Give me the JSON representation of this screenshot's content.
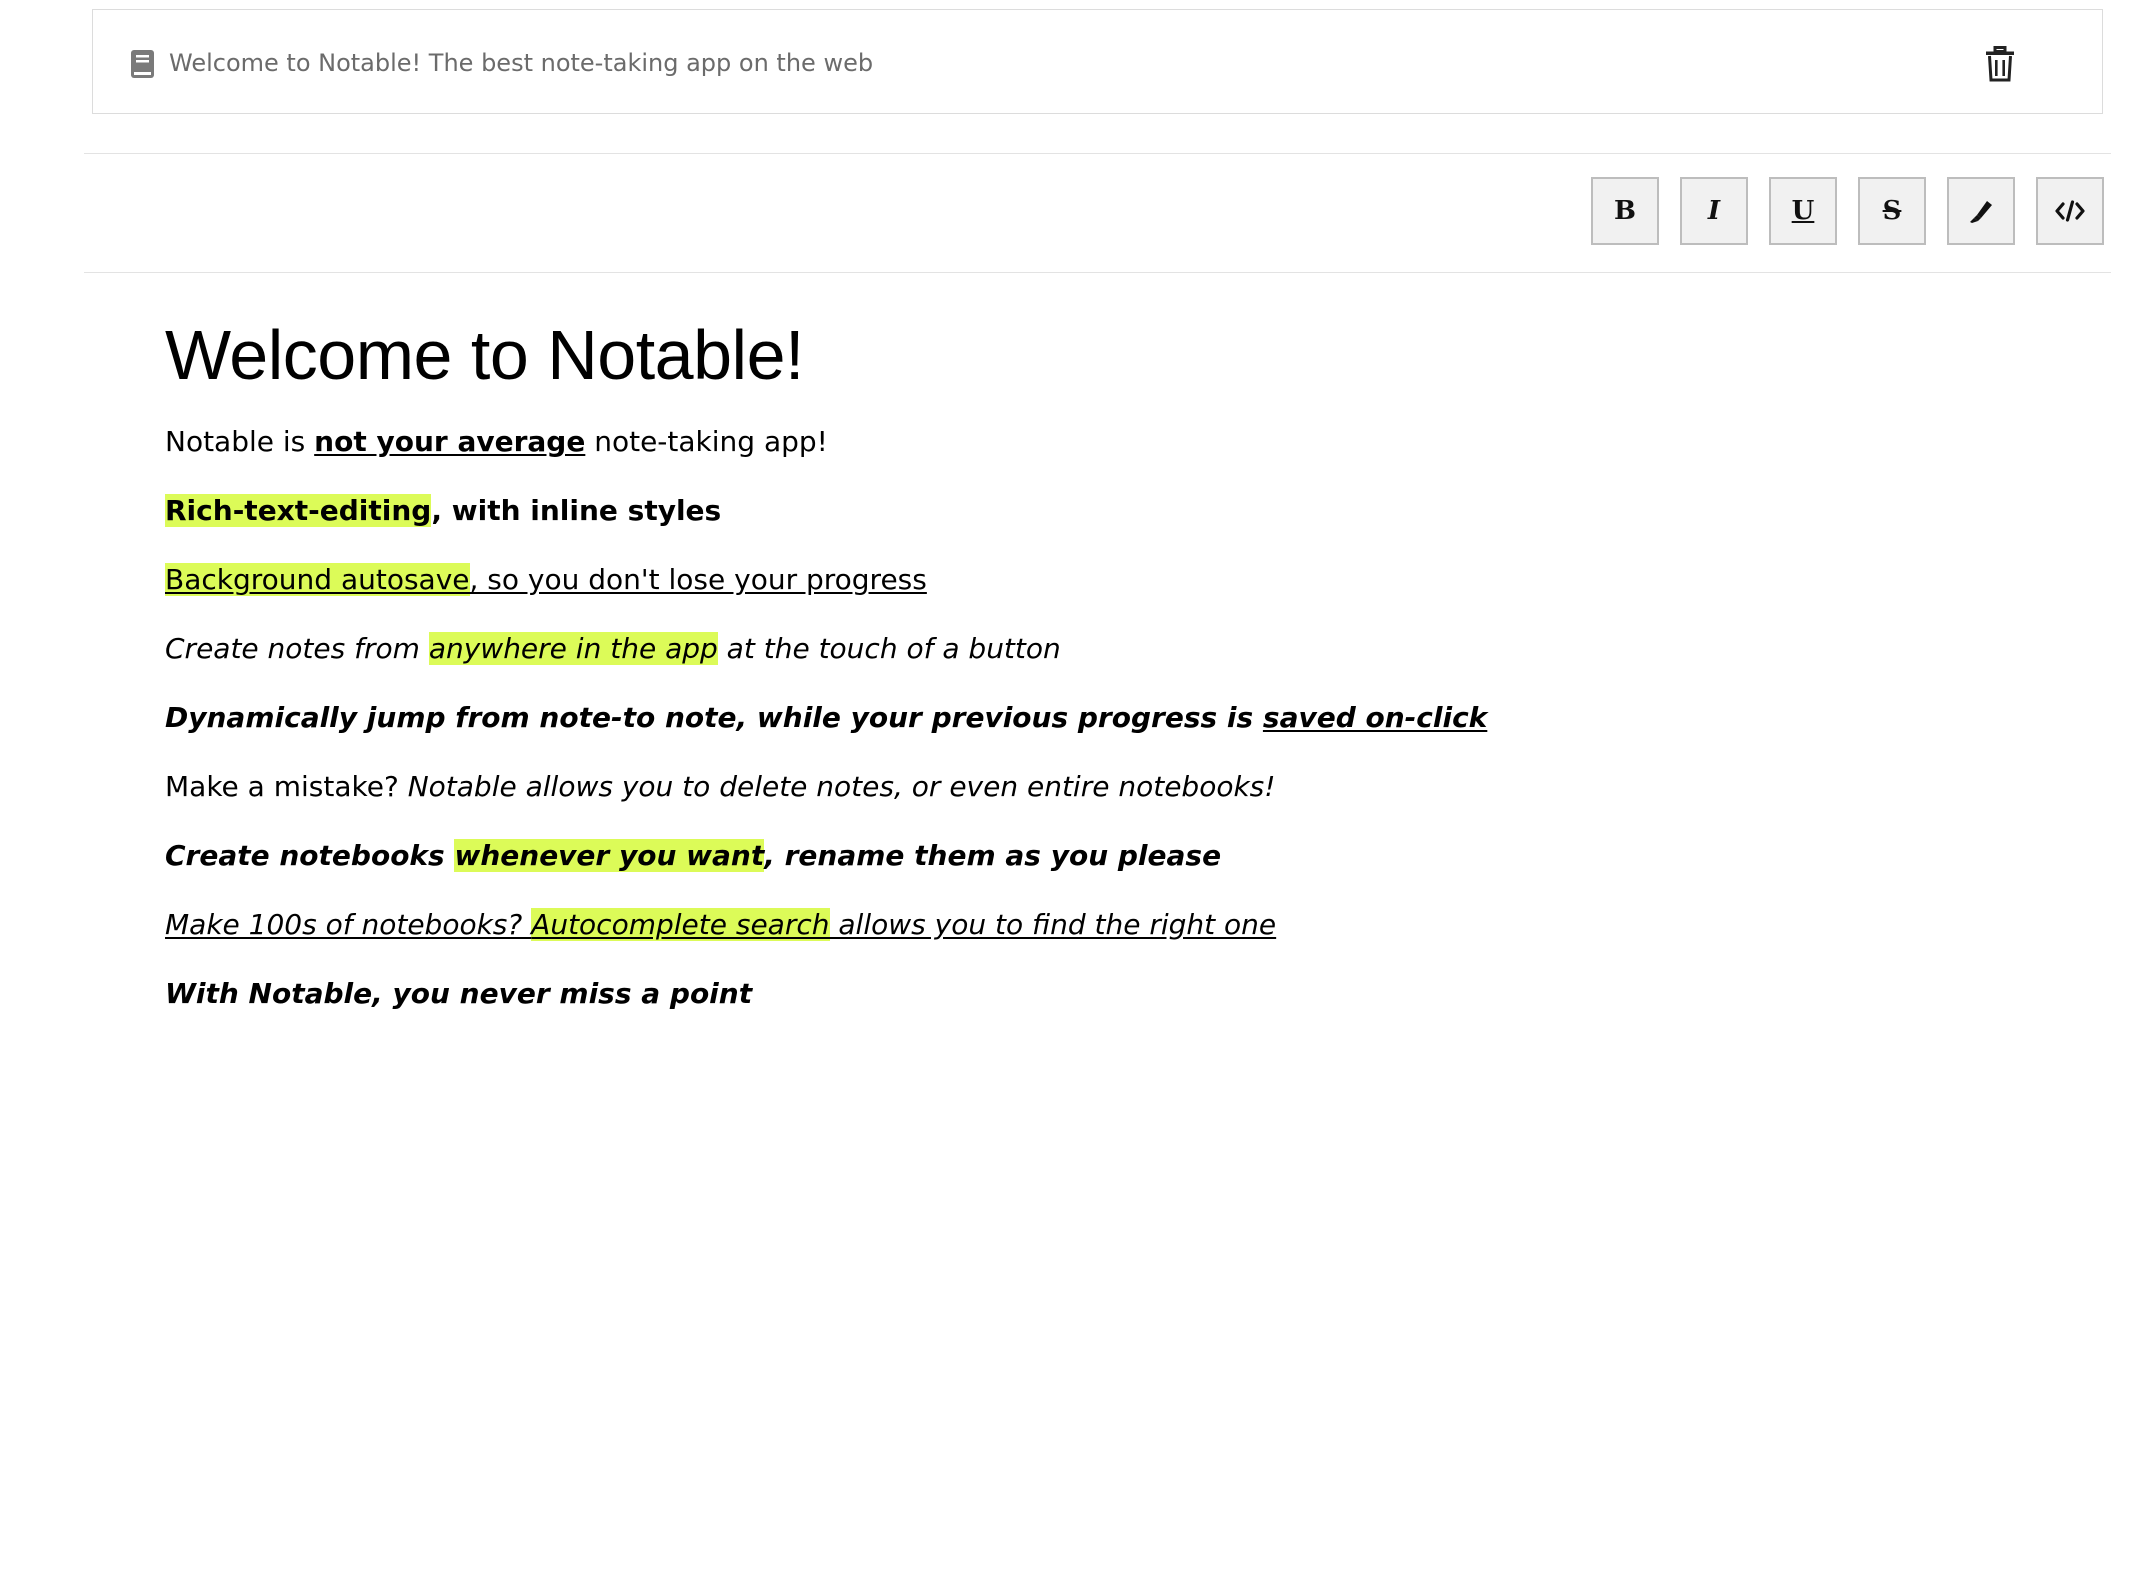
{
  "header": {
    "notebook_icon": "notebook-icon",
    "title": "Welcome to Notable! The best note-taking app on the web",
    "delete_icon": "trash-icon"
  },
  "toolbar": {
    "bold_label": "B",
    "italic_label": "I",
    "underline_label": "U",
    "strike_label": "S",
    "highlight_icon": "highlighter-icon",
    "code_icon": "code-icon"
  },
  "colors": {
    "highlight": "#dcfb58",
    "header_text": "#6b6b6b"
  },
  "note": {
    "heading": "Welcome to Notable!",
    "line1": {
      "a": "Notable is ",
      "b": "not your average",
      "c": " note-taking app!"
    },
    "line2": {
      "a": "Rich-text-editing",
      "b": ", with inline styles"
    },
    "line3": {
      "a": "Background autosave",
      "b": ", so you don't lose your progress"
    },
    "line4": {
      "a": "Create notes from ",
      "b": "anywhere in the app",
      "c": " at the touch of a button"
    },
    "line5": {
      "a": "Dynamically jump from note-to note, while your previous progress is ",
      "b": "saved on-click"
    },
    "line6": {
      "a": "Make a mistake? ",
      "b": "Notable allows you to delete notes, or even entire notebooks!"
    },
    "line7": {
      "a": "Create notebooks ",
      "b": "whenever you want",
      "c": ", rename them as you please"
    },
    "line8": {
      "a": "Make 100s of notebooks? ",
      "b": "Autocomplete search",
      "c": " allows you to find the right one"
    },
    "line9": "With Notable, you never miss a point"
  }
}
